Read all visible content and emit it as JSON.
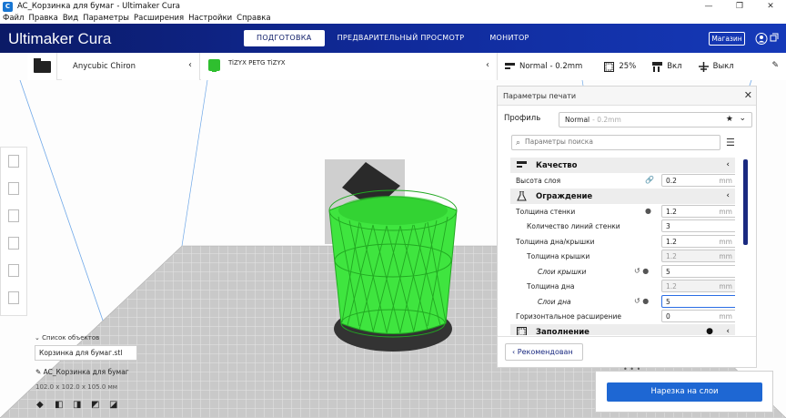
{
  "window": {
    "title": "AC_Корзинка для бумаг - Ultimaker Cura",
    "app_icon": "C"
  },
  "menubar": [
    "Файл",
    "Правка",
    "Вид",
    "Параметры",
    "Расширения",
    "Настройки",
    "Справка"
  ],
  "header": {
    "logo_brand": "Ultimaker",
    "logo_product": "Cura",
    "tabs": [
      "ПОДГОТОВКА",
      "ПРЕДВАРИТЕЛЬНЫЙ ПРОСМОТР",
      "МОНИТОР"
    ],
    "active_tab": "ПОДГОТОВКА",
    "shop_label": "Магазин"
  },
  "stage": {
    "printer_name": "Anycubic Chiron",
    "material_name": "TiZYX PETG TiZYX",
    "material_color": "#2fbf2f"
  },
  "summary": {
    "profile": "Normal - 0.2mm",
    "infill": "25%",
    "support": "Вкл",
    "adhesion": "Выкл"
  },
  "panel": {
    "title": "Параметры печати",
    "profile_label": "Профиль",
    "profile_name": "Normal",
    "profile_variant": "- 0.2mm",
    "search_placeholder": "Параметры поиска",
    "categories": {
      "quality": "Качество",
      "walls": "Ограждение",
      "infill": "Заполнение"
    },
    "rows": [
      {
        "label": "Высота слоя",
        "value": "0.2",
        "unit": "mm"
      },
      {
        "label": "Толщина стенки",
        "value": "1.2",
        "unit": "mm"
      },
      {
        "label": "Количество линий стенки",
        "value": "3",
        "unit": ""
      },
      {
        "label": "Толщина дна/крышки",
        "value": "1.2",
        "unit": "mm"
      },
      {
        "label": "Толщина крышки",
        "value": "1.2",
        "unit": "mm"
      },
      {
        "label": "Слои крышки",
        "value": "5",
        "unit": ""
      },
      {
        "label": "Толщина дна",
        "value": "1.2",
        "unit": "mm"
      },
      {
        "label": "Слои дна",
        "value": "5",
        "unit": ""
      },
      {
        "label": "Горизонтальное расширение",
        "value": "0",
        "unit": "mm"
      }
    ],
    "recommended_label": "Рекомендован"
  },
  "objects": {
    "header": "Список объектов",
    "file": "Корзинка для бумаг.stl",
    "job_name": "AC_Корзинка для бумаг",
    "dimensions": "102.0 x 102.0 x 105.0 мм"
  },
  "slice_label": "Нарезка на слои"
}
